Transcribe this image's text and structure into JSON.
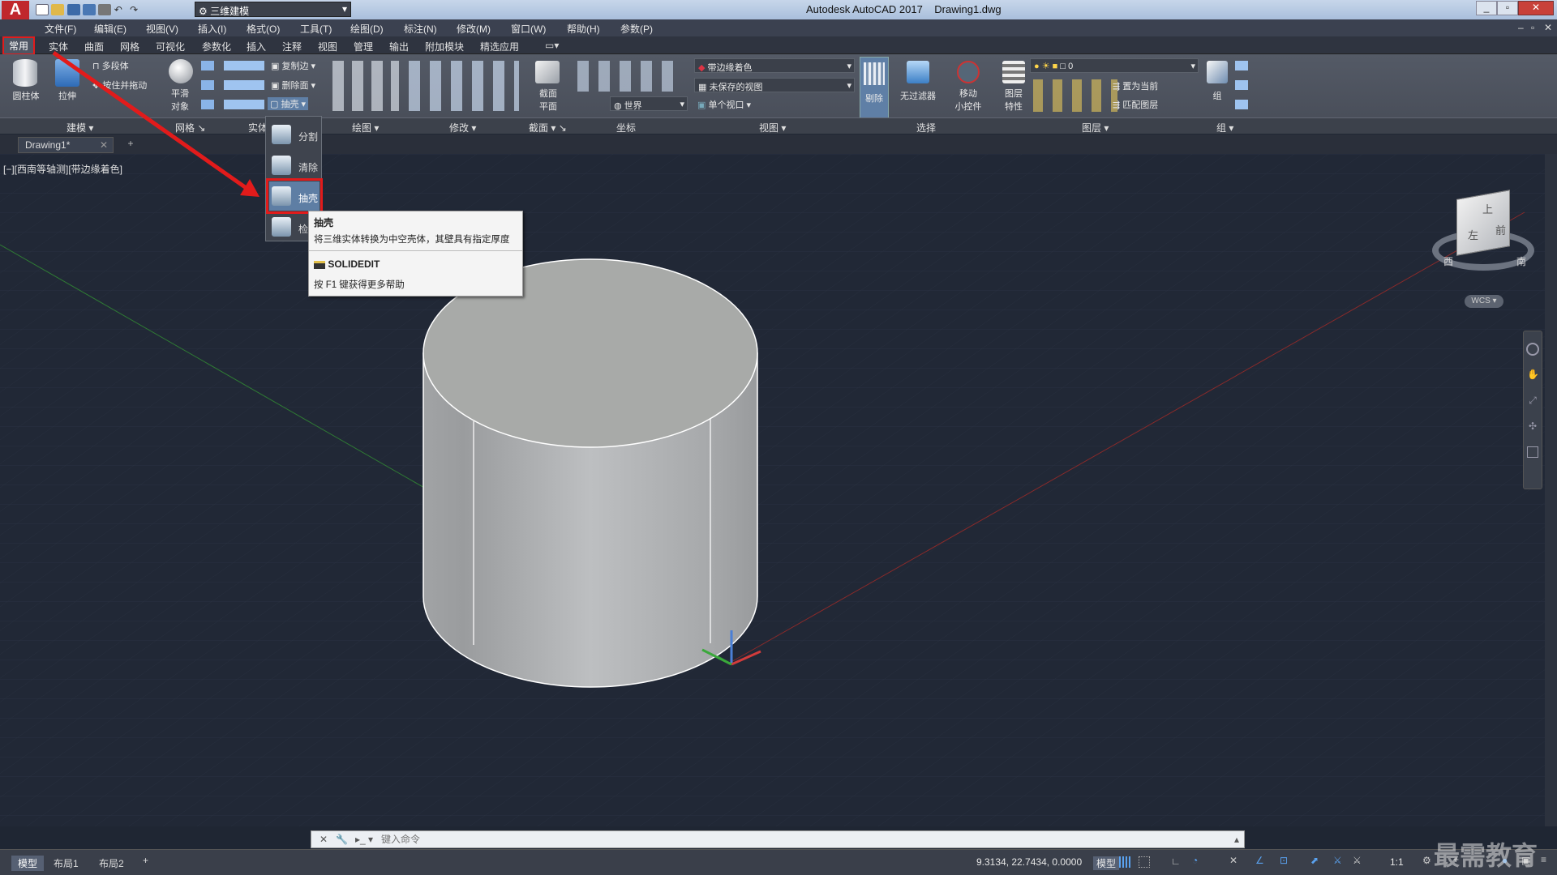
{
  "titlebar": {
    "app_title": "Autodesk AutoCAD 2017",
    "doc_title": "Drawing1.dwg",
    "workspace": "三维建模"
  },
  "menu": [
    "文件(F)",
    "编辑(E)",
    "视图(V)",
    "插入(I)",
    "格式(O)",
    "工具(T)",
    "绘图(D)",
    "标注(N)",
    "修改(M)",
    "窗口(W)",
    "帮助(H)",
    "参数(P)"
  ],
  "ribbon_tabs": [
    "常用",
    "实体",
    "曲面",
    "网格",
    "可视化",
    "参数化",
    "插入",
    "注释",
    "视图",
    "管理",
    "输出",
    "附加模块",
    "精选应用"
  ],
  "ribbon": {
    "cylinder": "圆柱体",
    "extrude": "拉伸",
    "polysolid": "多段体",
    "presspull": "按住并拖动",
    "smooth": "平滑",
    "smooth2": "对象",
    "copy_edge": "复制边",
    "delete_face": "删除面",
    "shell_small": "抽壳",
    "section_plane": "截面",
    "section_plane2": "平面",
    "visual_style": "带边缘着色",
    "saved_view": "未保存的视图",
    "ucs": "世界",
    "single_viewport": "单个视口",
    "cull": "剔除",
    "no_filter": "无过滤器",
    "gizmo": "移动",
    "gizmo2": "小控件",
    "layer_props": "图层",
    "layer_props2": "特性",
    "set_current": "置为当前",
    "match_layer": "匹配图层",
    "layer_value": "0",
    "group": "组"
  },
  "panels": [
    "建模",
    "网格",
    "实体",
    "绘图",
    "修改",
    "截面",
    "坐标",
    "视图",
    "选择",
    "图层",
    "组"
  ],
  "doc_tab": "Drawing1*",
  "viewport_label": "[−][西南等轴测][带边缘着色]",
  "flyout": [
    "分割",
    "清除",
    "抽壳",
    "检"
  ],
  "tooltip": {
    "title": "抽壳",
    "desc": "将三维实体转换为中空壳体，其壁具有指定厚度",
    "command": "SOLIDEDIT",
    "help": "按 F1 键获得更多帮助"
  },
  "viewcube": {
    "top": "上",
    "left": "左",
    "front": "前",
    "west": "西",
    "south": "南",
    "wcs": "WCS"
  },
  "command_placeholder": "键入命令",
  "layout_tabs": [
    "模型",
    "布局1",
    "布局2"
  ],
  "status": {
    "coords": "9.3134, 22.7434, 0.0000",
    "model": "模型",
    "scale": "1:1"
  },
  "watermark": "最需教育",
  "colors": {
    "accent_red": "#e21b1b",
    "viewport_bg": "#212836",
    "ribbon_bg": "#4c525d"
  }
}
